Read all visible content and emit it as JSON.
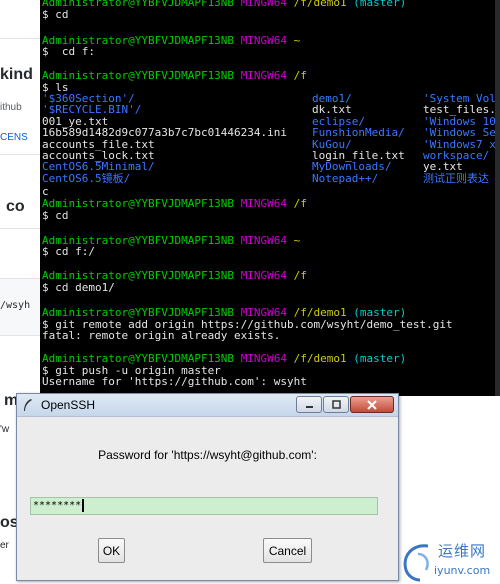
{
  "background_page": {
    "fragments": [
      "kind",
      "ithub",
      "CENS",
      "co",
      "/wsyh",
      "'w",
      "m",
      "os",
      "er"
    ]
  },
  "terminal": {
    "lines": [
      {
        "user": "Administrator@YYBFVJDMAPF13NB",
        "host": "MINGW64",
        "path": "/f/demo1",
        "branch": "(master)"
      },
      {
        "cmd": "$ cd"
      },
      {
        "user": "Administrator@YYBFVJDMAPF13NB",
        "host": "MINGW64",
        "path": "~"
      },
      {
        "cmd": "$  cd f:"
      },
      {
        "user": "Administrator@YYBFVJDMAPF13NB",
        "host": "MINGW64",
        "path": "/f"
      },
      {
        "cmd": "$ ls"
      }
    ],
    "ls_col1": [
      {
        "text": "'$360Section'/",
        "color": "blue"
      },
      {
        "text": "'$RECYCLE.BIN'/",
        "color": "blue"
      },
      {
        "text": "001_ye.txt",
        "color": "white"
      },
      {
        "text": "16b589d1482d9c077a3b7c7bc01446234.ini",
        "color": "white"
      },
      {
        "text": "accounts_file.txt",
        "color": "white"
      },
      {
        "text": "accounts_lock.txt",
        "color": "white"
      },
      {
        "text": "CentOS6.5Minimal/",
        "color": "blue"
      },
      {
        "text": "CentOS6.5镜板/",
        "color": "blue"
      }
    ],
    "ls_col2": [
      {
        "text": "demo1/",
        "color": "blue"
      },
      {
        "text": "dk.txt",
        "color": "white"
      },
      {
        "text": "eclipse/",
        "color": "blue"
      },
      {
        "text": "FunshionMedia/",
        "color": "blue"
      },
      {
        "text": "KuGou/",
        "color": "blue"
      },
      {
        "text": "login_file.txt",
        "color": "white"
      },
      {
        "text": "MyDownloads/",
        "color": "blue"
      },
      {
        "text": "Notepad++/",
        "color": "blue"
      }
    ],
    "ls_col3": [
      {
        "text": "'System Vol",
        "color": "blue"
      },
      {
        "text": "test_files.",
        "color": "white"
      },
      {
        "text": "'Windows 10",
        "color": "blue"
      },
      {
        "text": "'Windows Se",
        "color": "blue"
      },
      {
        "text": "'Windows7 x",
        "color": "blue"
      },
      {
        "text": "workspace/",
        "color": "blue"
      },
      {
        "text": "ye.txt",
        "color": "white"
      },
      {
        "text": "测试正则表达",
        "color": "blue"
      }
    ],
    "tail": [
      {
        "user": "Administrator@YYBFVJDMAPF13NB",
        "host": "MINGW64",
        "path": "/f"
      },
      {
        "cmd": "$ cd"
      },
      {
        "user": "Administrator@YYBFVJDMAPF13NB",
        "host": "MINGW64",
        "path": "~"
      },
      {
        "cmd": "$ cd f:/"
      },
      {
        "user": "Administrator@YYBFVJDMAPF13NB",
        "host": "MINGW64",
        "path": "/f"
      },
      {
        "cmd": "$ cd demo1/"
      },
      {
        "user": "Administrator@YYBFVJDMAPF13NB",
        "host": "MINGW64",
        "path": "/f/demo1",
        "branch": "(master)"
      },
      {
        "cmd": "$ git remote add origin https://github.com/wsyht/demo_test.git"
      },
      {
        "cmd": "fatal: remote origin already exists."
      },
      {
        "user": "Administrator@YYBFVJDMAPF13NB",
        "host": "MINGW64",
        "path": "/f/demo1",
        "branch": "(master)"
      },
      {
        "cmd": "$ git push -u origin master"
      },
      {
        "cmd": "Username for 'https://github.com': wsyht"
      }
    ]
  },
  "dialog": {
    "title": "OpenSSH",
    "prompt": "Password for 'https://wsyht@github.com':",
    "password_value": "********",
    "ok_label": "OK",
    "cancel_label": "Cancel"
  },
  "watermark": {
    "cn": "运维网",
    "en": "iyunv.com"
  }
}
